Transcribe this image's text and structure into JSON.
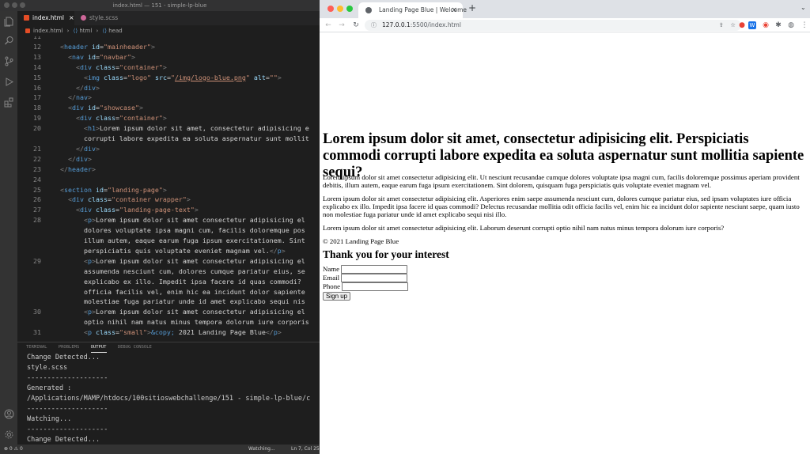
{
  "vscode": {
    "window_title": "index.html — 151 - simple-lp-blue",
    "tabs": [
      {
        "label": "index.html",
        "active": true,
        "icon": "html5-icon",
        "color": "#e44d26"
      },
      {
        "label": "style.scss",
        "active": false,
        "icon": "sass-icon",
        "color": "#cd6799"
      }
    ],
    "breadcrumb": [
      "index.html",
      "html",
      "head"
    ],
    "code_lines": [
      {
        "n": "11",
        "html": ""
      },
      {
        "n": "12",
        "html": "<span class=\"p\">&lt;</span><span class=\"t\">header</span> <span class=\"a\">id</span>=<span class=\"s\">\"mainheader\"</span><span class=\"p\">&gt;</span>"
      },
      {
        "n": "13",
        "html": "  <span class=\"p\">&lt;</span><span class=\"t\">nav</span> <span class=\"a\">id</span>=<span class=\"s\">\"navbar\"</span><span class=\"p\">&gt;</span>"
      },
      {
        "n": "14",
        "html": "    <span class=\"p\">&lt;</span><span class=\"t\">div</span> <span class=\"a\">class</span>=<span class=\"s\">\"container\"</span><span class=\"p\">&gt;</span>"
      },
      {
        "n": "15",
        "html": "      <span class=\"p\">&lt;</span><span class=\"t\">img</span> <span class=\"a\">class</span>=<span class=\"s\">\"logo\"</span> <span class=\"a\">src</span>=<span class=\"s\">\"<span class=\"u\">/img/logo-blue.png</span>\"</span> <span class=\"a\">alt</span>=<span class=\"s\">\"\"</span><span class=\"p\">&gt;</span>"
      },
      {
        "n": "16",
        "html": "    <span class=\"p\">&lt;/</span><span class=\"t\">div</span><span class=\"p\">&gt;</span>"
      },
      {
        "n": "17",
        "html": "  <span class=\"p\">&lt;/</span><span class=\"t\">nav</span><span class=\"p\">&gt;</span>"
      },
      {
        "n": "18",
        "html": "  <span class=\"p\">&lt;</span><span class=\"t\">div</span> <span class=\"a\">id</span>=<span class=\"s\">\"showcase\"</span><span class=\"p\">&gt;</span>"
      },
      {
        "n": "19",
        "html": "    <span class=\"p\">&lt;</span><span class=\"t\">div</span> <span class=\"a\">class</span>=<span class=\"s\">\"container\"</span><span class=\"p\">&gt;</span>"
      },
      {
        "n": "20",
        "html": "      <span class=\"p\">&lt;</span><span class=\"t\">h1</span><span class=\"p\">&gt;</span>Lorem ipsum dolor sit amet, consectetur adipisicing e"
      },
      {
        "n": "",
        "html": "      corrupti labore expedita ea soluta aspernatur sunt mollit"
      },
      {
        "n": "21",
        "html": "    <span class=\"p\">&lt;/</span><span class=\"t\">div</span><span class=\"p\">&gt;</span>"
      },
      {
        "n": "22",
        "html": "  <span class=\"p\">&lt;/</span><span class=\"t\">div</span><span class=\"p\">&gt;</span>"
      },
      {
        "n": "23",
        "html": "<span class=\"p\">&lt;/</span><span class=\"t\">header</span><span class=\"p\">&gt;</span>"
      },
      {
        "n": "24",
        "html": ""
      },
      {
        "n": "25",
        "html": "<span class=\"p\">&lt;</span><span class=\"t\">section</span> <span class=\"a\">id</span>=<span class=\"s\">\"landing-page\"</span><span class=\"p\">&gt;</span>"
      },
      {
        "n": "26",
        "html": "  <span class=\"p\">&lt;</span><span class=\"t\">div</span> <span class=\"a\">class</span>=<span class=\"s\">\"container wrapper\"</span><span class=\"p\">&gt;</span>"
      },
      {
        "n": "27",
        "html": "    <span class=\"p\">&lt;</span><span class=\"t\">div</span> <span class=\"a\">class</span>=<span class=\"s\">\"landing-page-text\"</span><span class=\"p\">&gt;</span>"
      },
      {
        "n": "28",
        "html": "      <span class=\"p\">&lt;</span><span class=\"t\">p</span><span class=\"p\">&gt;</span>Lorem ipsum dolor sit amet consectetur adipisicing el"
      },
      {
        "n": "",
        "html": "      dolores voluptate ipsa magni cum, facilis doloremque pos"
      },
      {
        "n": "",
        "html": "      illum autem, eaque earum fuga ipsum exercitationem. Sint"
      },
      {
        "n": "",
        "html": "      perspiciatis quis voluptate eveniet magnam vel.<span class=\"p\">&lt;/</span><span class=\"t\">p</span><span class=\"p\">&gt;</span>"
      },
      {
        "n": "29",
        "html": "      <span class=\"p\">&lt;</span><span class=\"t\">p</span><span class=\"p\">&gt;</span>Lorem ipsum dolor sit amet consectetur adipisicing el"
      },
      {
        "n": "",
        "html": "      assumenda nesciunt cum, dolores cumque pariatur eius, se"
      },
      {
        "n": "",
        "html": "      explicabo ex illo. Impedit ipsa facere id quas commodi? "
      },
      {
        "n": "",
        "html": "      officia facilis vel, enim hic ea incidunt dolor sapiente"
      },
      {
        "n": "",
        "html": "      molestiae fuga pariatur unde id amet explicabo sequi nis"
      },
      {
        "n": "30",
        "html": "      <span class=\"p\">&lt;</span><span class=\"t\">p</span><span class=\"p\">&gt;</span>Lorem ipsum dolor sit amet consectetur adipisicing el"
      },
      {
        "n": "",
        "html": "      optio nihil nam natus minus tempora dolorum iure corporis"
      },
      {
        "n": "31",
        "html": "      <span class=\"p\">&lt;</span><span class=\"t\">p</span> <span class=\"a\">class</span>=<span class=\"s\">\"small\"</span><span class=\"p\">&gt;</span><span class=\"e\">&amp;copy;</span> 2021 Landing Page Blue<span class=\"p\">&lt;/</span><span class=\"t\">p</span><span class=\"p\">&gt;</span>"
      }
    ],
    "panel_tabs": [
      "TERMINAL",
      "PROBLEMS",
      "OUTPUT",
      "DEBUG CONSOLE"
    ],
    "panel_active": "OUTPUT",
    "output_lines": [
      "Change Detected...",
      "style.scss",
      "--------------------",
      "Generated :",
      "/Applications/MAMP/htdocs/100sitioswebchallenge/151 - simple-lp-blue/c",
      "--------------------",
      "Watching...",
      "--------------------",
      "Change Detected..."
    ],
    "status": {
      "problems": "⊗ 0 ⚠ 0",
      "watching": "Watching...",
      "position": "Ln 7, Col 25"
    }
  },
  "chrome": {
    "tab_title": "Landing Page Blue | Welcome",
    "url_host": "127.0.0.1",
    "url_rest": ":5500/index.html",
    "colors": {
      "close": "#fe5f57",
      "minimize": "#febc2e",
      "maximize": "#28c840"
    }
  },
  "page": {
    "h1": "Lorem ipsum dolor sit amet, consectetur adipisicing elit. Perspiciatis commodi corrupti labore expedita ea soluta aspernatur sunt mollitia sapiente sequi?",
    "paragraphs": [
      "Lorem ipsum dolor sit amet consectetur adipisicing elit. Ut nesciunt recusandae cumque dolores voluptate ipsa magni cum, facilis doloremque possimus aperiam provident debitis, illum autem, eaque earum fuga ipsum exercitationem. Sint dolorem, quisquam fuga perspiciatis quis voluptate eveniet magnam vel.",
      "Lorem ipsum dolor sit amet consectetur adipisicing elit. Asperiores enim saepe assumenda nesciunt cum, dolores cumque pariatur eius, sed ipsam voluptates iure officia explicabo ex illo. Impedit ipsa facere id quas commodi? Delectus recusandae mollitia odit officia facilis vel, enim hic ea incidunt dolor sapiente nesciunt saepe, quam iusto non molestiae fuga pariatur unde id amet explicabo sequi nisi illo.",
      "Lorem ipsum dolor sit amet consectetur adipisicing elit. Laborum deserunt corrupti optio nihil nam natus minus tempora dolorum iure corporis?"
    ],
    "copyright": "© 2021 Landing Page Blue",
    "form_title": "Thank you for your interest",
    "form_labels": {
      "name": "Name",
      "email": "Email",
      "phone": "Phone"
    },
    "submit_label": "Sign up"
  }
}
